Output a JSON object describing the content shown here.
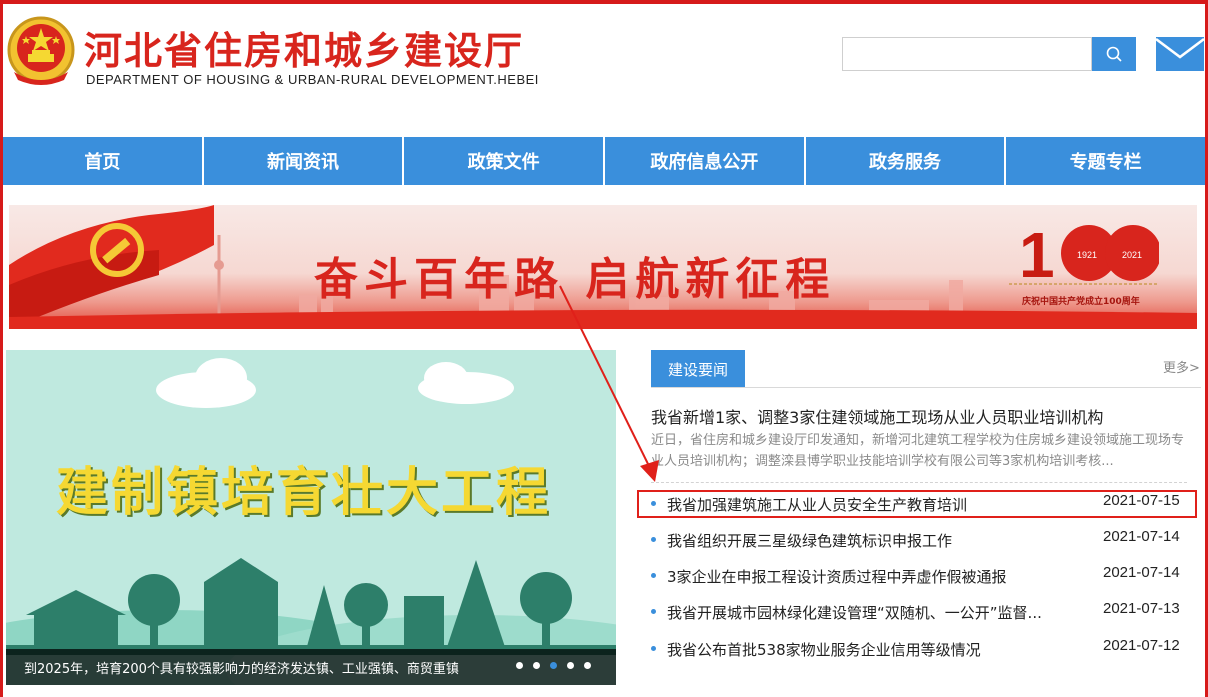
{
  "header": {
    "title": "河北省住房和城乡建设厅",
    "subtitle": "DEPARTMENT OF HOUSING & URBAN-RURAL DEVELOPMENT.HEBEI",
    "search_placeholder": "",
    "emblem_icon": "national-emblem-icon",
    "mail_icon": "mail-icon"
  },
  "nav": {
    "items": [
      "首页",
      "新闻资讯",
      "政策文件",
      "政府信息公开",
      "政务服务",
      "专题专栏"
    ]
  },
  "banner": {
    "slogan": "奋斗百年路  启航新征程",
    "badge_years_left": "1921",
    "badge_years_right": "2021",
    "caption": "庆祝中国共产党成立100周年"
  },
  "slideshow": {
    "headline": "建制镇培育壮大工程",
    "caption": "到2025年，培育200个具有较强影响力的经济发达镇、工业强镇、商贸重镇",
    "dot_count": 5,
    "active_dot": 3
  },
  "news": {
    "tab_label": "建设要闻",
    "more_label": "更多>",
    "featured": {
      "title": "我省新增1家、调整3家住建领域施工现场从业人员职业培训机构",
      "summary": "近日，省住房和城乡建设厅印发通知，新增河北建筑工程学校为住房城乡建设领域施工现场专业人员培训机构；调整滦县博学职业技能培训学校有限公司等3家机构培训考核..."
    },
    "items": [
      {
        "title": "我省加强建筑施工从业人员安全生产教育培训",
        "date": "2021-07-15"
      },
      {
        "title": "我省组织开展三星级绿色建筑标识申报工作",
        "date": "2021-07-14"
      },
      {
        "title": "3家企业在申报工程设计资质过程中弄虚作假被通报",
        "date": "2021-07-14"
      },
      {
        "title": "我省开展城市园林绿化建设管理“双随机、一公开”监督...",
        "date": "2021-07-13"
      },
      {
        "title": "我省公布首批538家物业服务企业信用等级情况",
        "date": "2021-07-12"
      }
    ]
  },
  "colors": {
    "brand_red": "#d8251d",
    "nav_blue": "#3a8fdc",
    "annotation_red": "#e0201a"
  }
}
